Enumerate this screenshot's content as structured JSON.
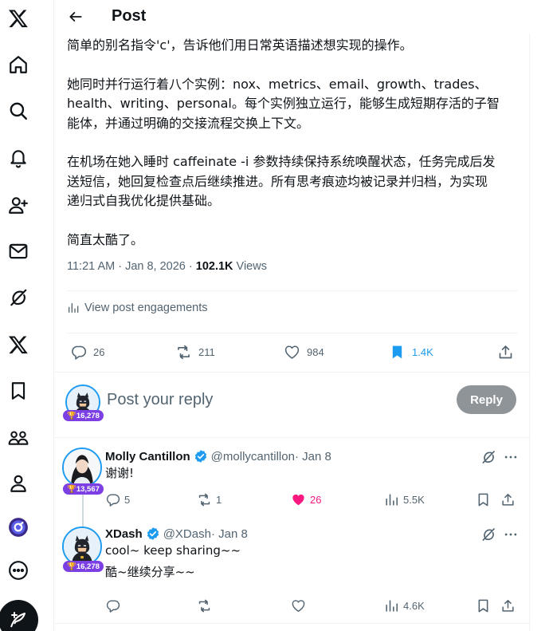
{
  "colors": {
    "accent": "#1d9bf0",
    "like": "#f91880",
    "badge": "#7b3fe4",
    "muted": "#536471",
    "reply_button": "#8f9499"
  },
  "nav": {
    "items": [
      {
        "icon": "x-logo-icon"
      },
      {
        "icon": "home-icon"
      },
      {
        "icon": "search-icon"
      },
      {
        "icon": "notifications-bell-icon"
      },
      {
        "icon": "follow-add-user-icon"
      },
      {
        "icon": "messages-envelope-icon"
      },
      {
        "icon": "grok-icon"
      },
      {
        "icon": "premium-x-icon"
      },
      {
        "icon": "bookmarks-icon"
      },
      {
        "icon": "communities-icon"
      },
      {
        "icon": "profile-icon"
      },
      {
        "icon": "app-extension-icon"
      },
      {
        "icon": "more-circle-icon"
      }
    ],
    "compose_icon": "compose-post-icon"
  },
  "header": {
    "title": "Post"
  },
  "post": {
    "paragraphs": [
      "简单的别名指令'c'，告诉他们用日常英语描述想实现的操作。",
      "她同时并行运行着八个实例：nox、metrics、email、growth、trades、\nhealth、writing、personal。每个实例独立运行，能够生成短期存活的子智\n能体，并通过明确的交接流程交换上下文。",
      "在机场在她入睡时 caffeinate -i 参数持续保持系统唤醒状态，任务完成后发\n送短信，她回复检查点后继续推进。所有思考痕迹均被记录并归档，为实现\n递归式自我优化提供基础。",
      "简直太酷了。"
    ],
    "timestamp": "11:21 AM · Jan 8, 2026 · ",
    "views_count": "102.1K",
    "views_label": " Views",
    "engagements_label": "View post engagements",
    "stats": {
      "replies": "26",
      "reposts": "211",
      "likes": "984",
      "bookmarks": "1.4K"
    }
  },
  "reply_composer": {
    "placeholder": "Post your reply",
    "button": "Reply",
    "badge": "🏆16,278"
  },
  "replies": [
    {
      "name": "Molly Cantillon",
      "handle": "@mollycantillon",
      "date": " · Jan 8",
      "text": "谢谢!",
      "badge": "🏆13,567",
      "stats": {
        "replies": "5",
        "reposts": "1",
        "likes": "26",
        "views": "5.5K"
      }
    },
    {
      "name": "XDash",
      "handle": "@XDash",
      "date": " · Jan 8",
      "text": "cool~ keep sharing~~\n酷~继续分享~~",
      "badge": "🏆16,278",
      "stats": {
        "replies": "",
        "reposts": "",
        "likes": "",
        "views": "4.6K"
      }
    }
  ]
}
